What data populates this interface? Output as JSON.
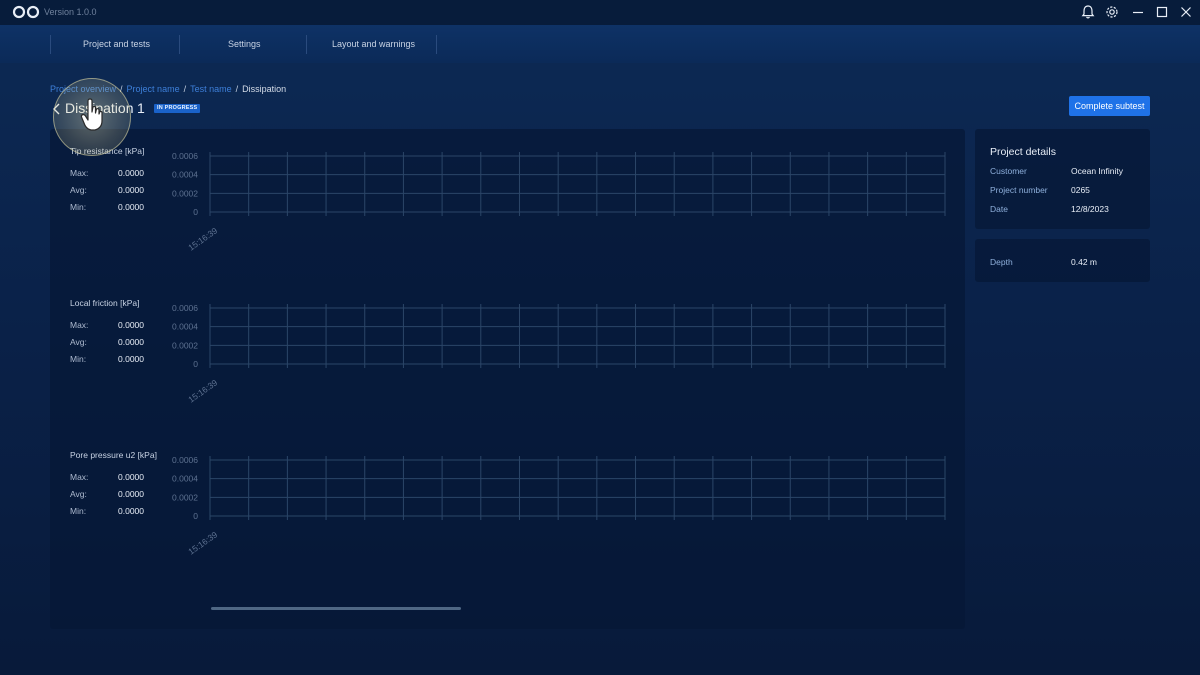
{
  "app": {
    "version": "Version 1.0.0",
    "icons": [
      "infinity-logo-icon",
      "bell-icon",
      "gear-icon",
      "minimize-icon",
      "maximize-icon",
      "close-icon"
    ]
  },
  "nav": {
    "items": [
      {
        "label": "Project and tests"
      },
      {
        "label": "Settings"
      },
      {
        "label": "Layout and warnings"
      }
    ]
  },
  "breadcrumb": {
    "items": [
      "Project overview",
      "Project name",
      "Test name"
    ],
    "separator": "/",
    "current": "Dissipation"
  },
  "page": {
    "title": "Dissipation",
    "number": "1",
    "status": "IN PROGRESS",
    "complete_button": "Complete subtest"
  },
  "charts": [
    {
      "label": "Tip resistance [kPa]",
      "stats": [
        {
          "name": "Max:",
          "value": "0.0000"
        },
        {
          "name": "Avg:",
          "value": "0.0000"
        },
        {
          "name": "Min:",
          "value": "0.0000"
        }
      ],
      "y_ticks": [
        "0.0006",
        "0.0004",
        "0.0002",
        "0"
      ],
      "x_ticks": [
        "15:16:39"
      ]
    },
    {
      "label": "Local friction [kPa]",
      "stats": [
        {
          "name": "Max:",
          "value": "0.0000"
        },
        {
          "name": "Avg:",
          "value": "0.0000"
        },
        {
          "name": "Min:",
          "value": "0.0000"
        }
      ],
      "y_ticks": [
        "0.0006",
        "0.0004",
        "0.0002",
        "0"
      ],
      "x_ticks": [
        "15:16:39"
      ]
    },
    {
      "label": "Pore pressure u2 [kPa]",
      "stats": [
        {
          "name": "Max:",
          "value": "0.0000"
        },
        {
          "name": "Avg:",
          "value": "0.0000"
        },
        {
          "name": "Min:",
          "value": "0.0000"
        }
      ],
      "y_ticks": [
        "0.0006",
        "0.0004",
        "0.0002",
        "0"
      ],
      "x_ticks": [
        "15:16:39"
      ]
    }
  ],
  "project_details": {
    "title": "Project details",
    "rows": [
      {
        "label": "Customer",
        "value": "Ocean Infinity"
      },
      {
        "label": "Project number",
        "value": "0265"
      },
      {
        "label": "Date",
        "value": "12/8/2023"
      }
    ]
  },
  "depth": {
    "label": "Depth",
    "value": "0.42 m"
  },
  "colors": {
    "accent": "#1f72e8",
    "badge": "#1a62c9",
    "link": "#3d7fd9",
    "grid": "#2b4668"
  }
}
